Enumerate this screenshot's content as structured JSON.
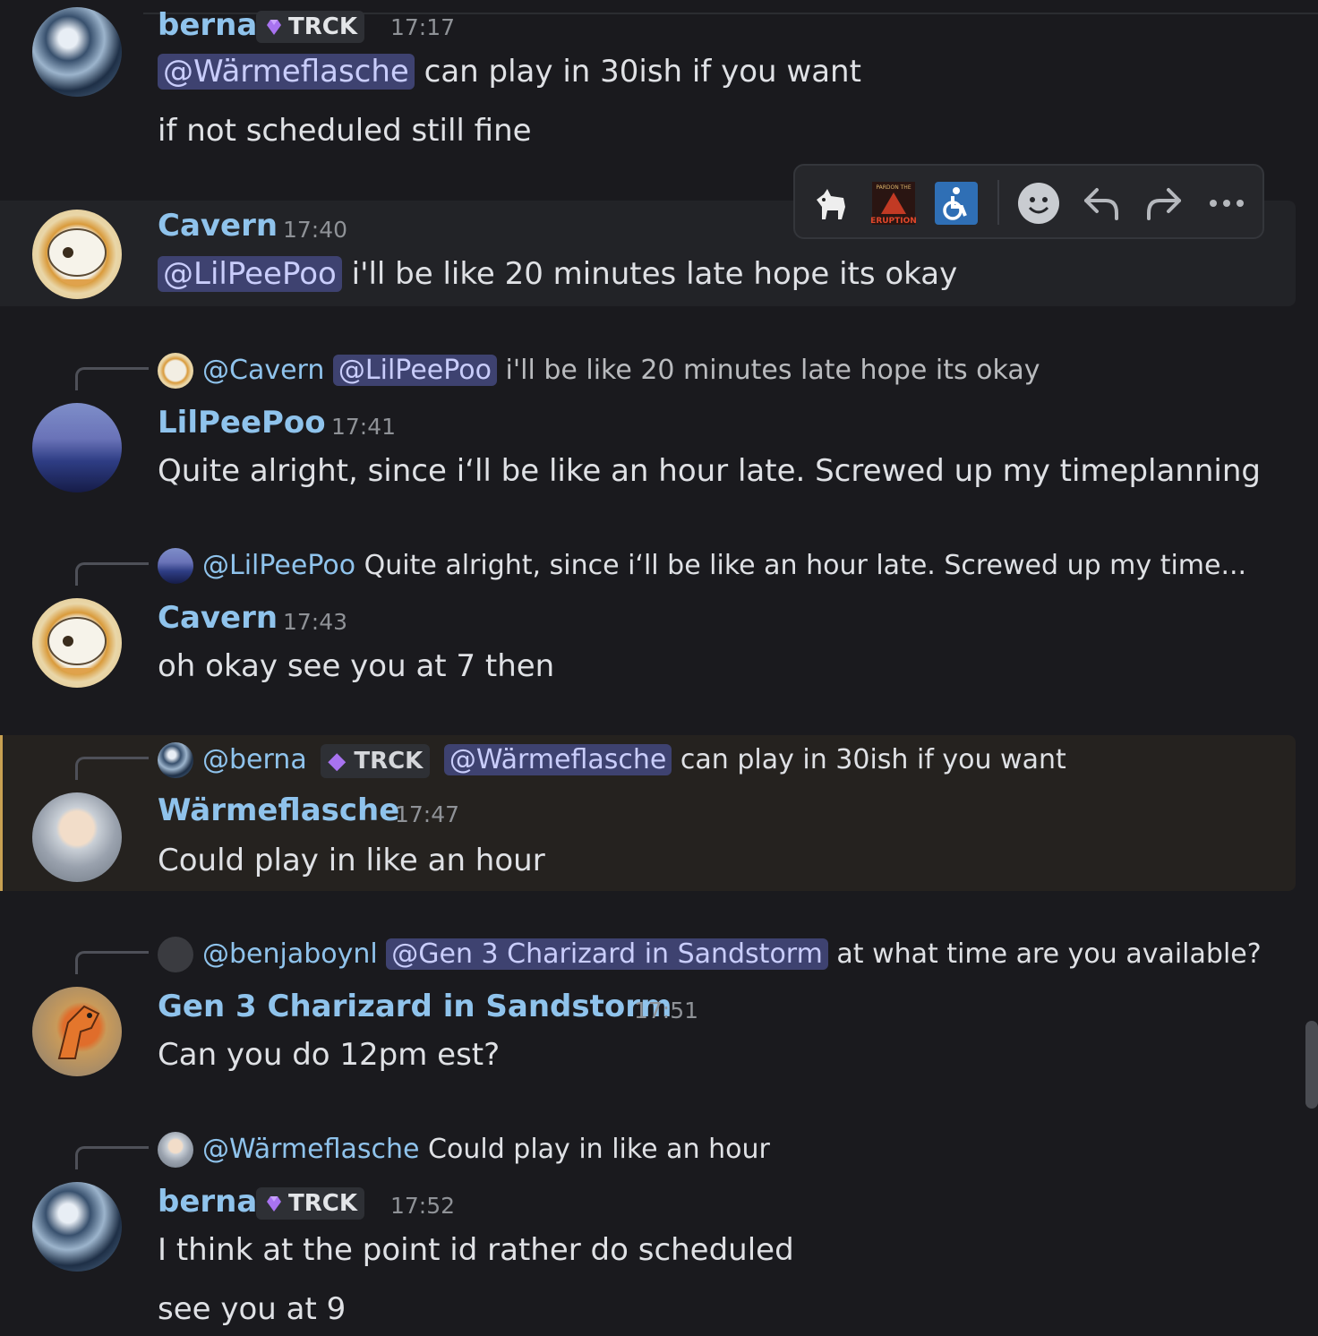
{
  "messages": [
    {
      "username": "berna",
      "tag": "TRCK",
      "time": "17:17",
      "mention": "@Wärmeflasche",
      "line1_rest": "can play in 30ish if you want",
      "line2": "if not scheduled still fine"
    },
    {
      "username": "Cavern",
      "time": "17:40",
      "mention": "@LilPeePoo",
      "line1_rest": "i'll be like 20 minutes late hope its okay"
    },
    {
      "reply": {
        "name": "@Cavern",
        "mention": "@LilPeePoo",
        "text": "i'll be like 20 minutes late hope its okay"
      },
      "username": "LilPeePoo",
      "time": "17:41",
      "line1": "Quite alright, since i‘ll be like an hour late. Screwed up my timeplanning"
    },
    {
      "reply": {
        "name": "@LilPeePoo",
        "text": "Quite alright, since i‘ll be like an hour late. Screwed up my time..."
      },
      "username": "Cavern",
      "time": "17:43",
      "line1": "oh okay see you at 7 then"
    },
    {
      "reply": {
        "name": "@berna",
        "tag": "TRCK",
        "mention": "@Wärmeflasche",
        "text": "can play in 30ish if you want"
      },
      "username": "Wärmeflasche",
      "time": "17:47",
      "line1": "Could play in like an hour"
    },
    {
      "reply": {
        "name": "@benjaboynl",
        "mention": "@Gen 3 Charizard in Sandstorm",
        "text": "at what time are you available?"
      },
      "username": "Gen 3 Charizard in Sandstorm",
      "time": "17:51",
      "line1": "Can you do 12pm est?"
    },
    {
      "reply": {
        "name": "@Wärmeflasche",
        "text": "Could play in like an hour"
      },
      "username": "berna",
      "tag": "TRCK",
      "time": "17:52",
      "line1": "I think at the point id rather do scheduled",
      "line2": "see you at 9"
    }
  ],
  "toolbar": {
    "items": [
      "goat-emoji-reaction",
      "eruption-emoji-reaction",
      "accessibility-emoji-reaction",
      "add-reaction",
      "reply",
      "forward",
      "more"
    ],
    "eruption_text": "ERUPTION",
    "pardon_text": "PARDON THE"
  },
  "colors": {
    "background": "#1a1a1e",
    "username": "#8fc3ec",
    "mention_bg": "#3e4270",
    "mentioned_highlight": "#c8a152"
  }
}
